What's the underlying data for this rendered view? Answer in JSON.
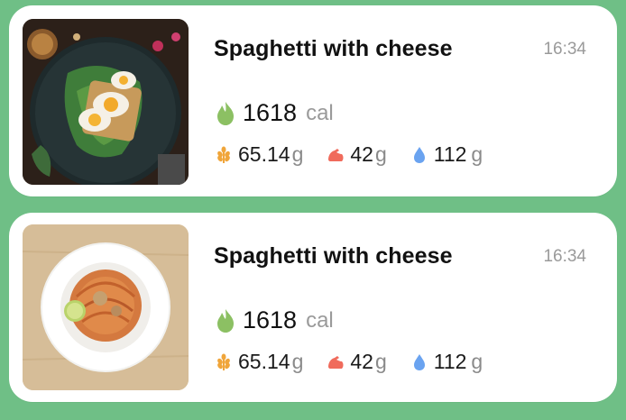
{
  "colors": {
    "background": "#6fbf86",
    "card": "#ffffff",
    "calorie_icon": "#8cc063",
    "carbs_icon": "#f0a53a",
    "protein_icon": "#f06b5c",
    "water_icon": "#6aa3f0"
  },
  "meals": [
    {
      "photo": "egg-avocado-toast-photo",
      "title": "Spaghetti with cheese",
      "time": "16:34",
      "calories": "1618",
      "calories_unit": "cal",
      "carbs": "65.14",
      "carbs_unit": "g",
      "protein": "42",
      "protein_unit": "g",
      "water": "112",
      "water_unit": "g"
    },
    {
      "photo": "spaghetti-plate-photo",
      "title": "Spaghetti with cheese",
      "time": "16:34",
      "calories": "1618",
      "calories_unit": "cal",
      "carbs": "65.14",
      "carbs_unit": "g",
      "protein": "42",
      "protein_unit": "g",
      "water": "112",
      "water_unit": "g"
    }
  ]
}
